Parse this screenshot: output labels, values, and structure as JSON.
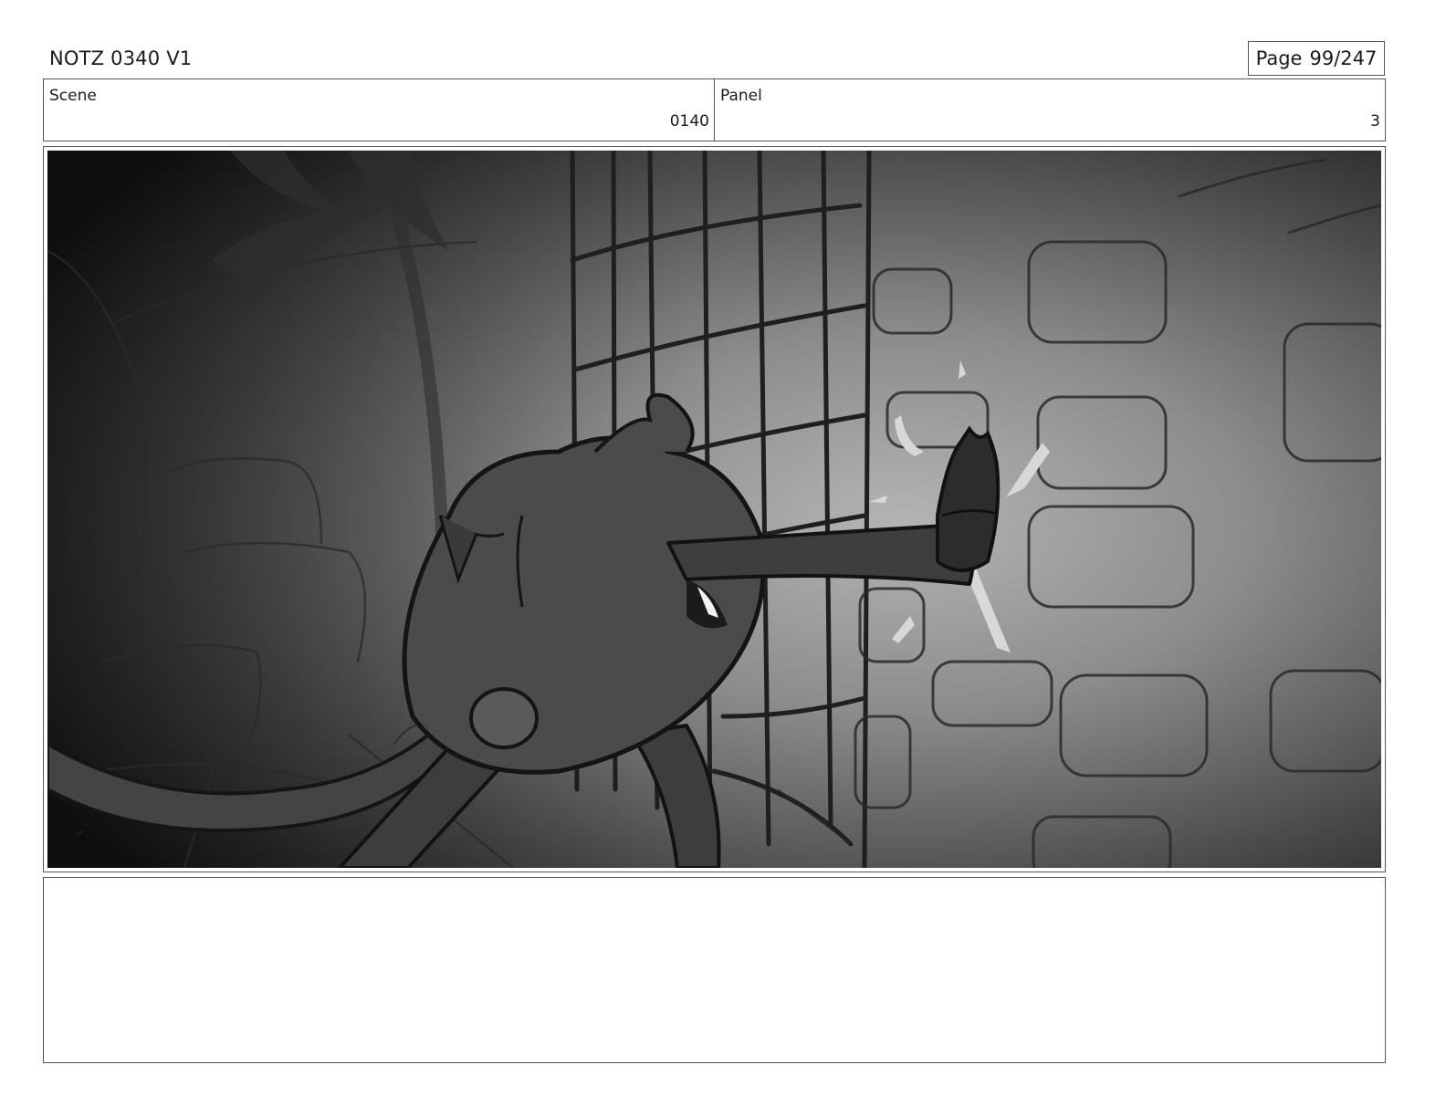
{
  "header": {
    "title": "NOTZ 0340 V1",
    "page_label": "Page",
    "page_number": "99/247"
  },
  "info": {
    "scene_label": "Scene",
    "scene_value": "0140",
    "panel_label": "Panel",
    "panel_value": "3"
  },
  "frame": {
    "image_description": "storyboard-sketch",
    "palette": {
      "ink": "#1e1e1e",
      "body": "#4a4a4a",
      "light": "#cfcfcf",
      "vignette": "#141414"
    }
  },
  "notes": {
    "text": ""
  }
}
